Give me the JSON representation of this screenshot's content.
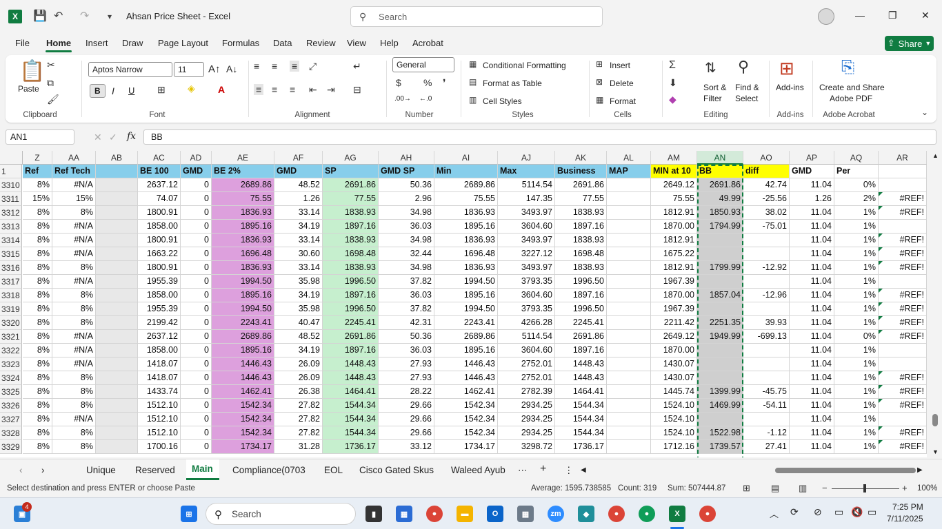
{
  "title": "Ahsan Price Sheet  -  Excel",
  "search_placeholder": "Search",
  "menu": [
    "File",
    "Home",
    "Insert",
    "Draw",
    "Page Layout",
    "Formulas",
    "Data",
    "Review",
    "View",
    "Help",
    "Acrobat"
  ],
  "share_label": "Share",
  "ribbon": {
    "clipboard": {
      "paste": "Paste",
      "label": "Clipboard"
    },
    "font": {
      "name": "Aptos Narrow",
      "size": "11",
      "label": "Font"
    },
    "alignment": {
      "label": "Alignment"
    },
    "number": {
      "format": "General",
      "label": "Number"
    },
    "styles": {
      "conditional": "Conditional Formatting",
      "format_table": "Format as Table",
      "cell_styles": "Cell Styles",
      "label": "Styles"
    },
    "cells": {
      "insert": "Insert",
      "delete": "Delete",
      "format": "Format",
      "label": "Cells"
    },
    "editing": {
      "sort": "Sort &",
      "filter": "Filter",
      "find": "Find &",
      "select": "Select",
      "label": "Editing"
    },
    "addins": {
      "addins": "Add-ins",
      "label": "Add-ins"
    },
    "acrobat": {
      "create1": "Create and Share",
      "create2": "Adobe PDF",
      "label": "Adobe Acrobat"
    }
  },
  "namebox": "AN1",
  "formula": "BB",
  "columns": [
    "Z",
    "AA",
    "AB",
    "AC",
    "AD",
    "AE",
    "AF",
    "AG",
    "AH",
    "AI",
    "AJ",
    "AK",
    "AL",
    "AM",
    "AN",
    "AO",
    "AP",
    "AQ",
    "AR"
  ],
  "header_row": {
    "num": "1",
    "cells": [
      "Ref",
      "Ref Tech",
      "",
      "BE 100",
      "GMD",
      "BE 2%",
      "GMD",
      "SP",
      "GMD SP",
      "Min",
      "Max",
      "Business",
      "MAP",
      "MIN at 10",
      "BB",
      "diff",
      "GMD",
      "Per",
      ""
    ]
  },
  "rows": [
    {
      "num": "3310",
      "cells": [
        "8%",
        "#N/A",
        "",
        "2637.12",
        "0",
        "2689.86",
        "48.52",
        "2691.86",
        "50.36",
        "2689.86",
        "5114.54",
        "2691.86",
        "",
        "2649.12",
        "2691.86",
        "42.74",
        "11.04",
        "0%",
        ""
      ]
    },
    {
      "num": "3311",
      "cells": [
        "15%",
        "15%",
        "",
        "74.07",
        "0",
        "75.55",
        "1.26",
        "77.55",
        "2.96",
        "75.55",
        "147.35",
        "77.55",
        "",
        "75.55",
        "49.99",
        "-25.56",
        "1.26",
        "2%",
        "#REF!"
      ]
    },
    {
      "num": "3312",
      "cells": [
        "8%",
        "8%",
        "",
        "1800.91",
        "0",
        "1836.93",
        "33.14",
        "1838.93",
        "34.98",
        "1836.93",
        "3493.97",
        "1838.93",
        "",
        "1812.91",
        "1850.93",
        "38.02",
        "11.04",
        "1%",
        "#REF!"
      ]
    },
    {
      "num": "3313",
      "cells": [
        "8%",
        "#N/A",
        "",
        "1858.00",
        "0",
        "1895.16",
        "34.19",
        "1897.16",
        "36.03",
        "1895.16",
        "3604.60",
        "1897.16",
        "",
        "1870.00",
        "1794.99",
        "-75.01",
        "11.04",
        "1%",
        ""
      ]
    },
    {
      "num": "3314",
      "cells": [
        "8%",
        "#N/A",
        "",
        "1800.91",
        "0",
        "1836.93",
        "33.14",
        "1838.93",
        "34.98",
        "1836.93",
        "3493.97",
        "1838.93",
        "",
        "1812.91",
        "",
        "",
        "11.04",
        "1%",
        "#REF!"
      ]
    },
    {
      "num": "3315",
      "cells": [
        "8%",
        "#N/A",
        "",
        "1663.22",
        "0",
        "1696.48",
        "30.60",
        "1698.48",
        "32.44",
        "1696.48",
        "3227.12",
        "1698.48",
        "",
        "1675.22",
        "",
        "",
        "11.04",
        "1%",
        "#REF!"
      ]
    },
    {
      "num": "3316",
      "cells": [
        "8%",
        "8%",
        "",
        "1800.91",
        "0",
        "1836.93",
        "33.14",
        "1838.93",
        "34.98",
        "1836.93",
        "3493.97",
        "1838.93",
        "",
        "1812.91",
        "1799.99",
        "-12.92",
        "11.04",
        "1%",
        "#REF!"
      ]
    },
    {
      "num": "3317",
      "cells": [
        "8%",
        "#N/A",
        "",
        "1955.39",
        "0",
        "1994.50",
        "35.98",
        "1996.50",
        "37.82",
        "1994.50",
        "3793.35",
        "1996.50",
        "",
        "1967.39",
        "",
        "",
        "11.04",
        "1%",
        ""
      ]
    },
    {
      "num": "3318",
      "cells": [
        "8%",
        "8%",
        "",
        "1858.00",
        "0",
        "1895.16",
        "34.19",
        "1897.16",
        "36.03",
        "1895.16",
        "3604.60",
        "1897.16",
        "",
        "1870.00",
        "1857.04",
        "-12.96",
        "11.04",
        "1%",
        "#REF!"
      ]
    },
    {
      "num": "3319",
      "cells": [
        "8%",
        "8%",
        "",
        "1955.39",
        "0",
        "1994.50",
        "35.98",
        "1996.50",
        "37.82",
        "1994.50",
        "3793.35",
        "1996.50",
        "",
        "1967.39",
        "",
        "",
        "11.04",
        "1%",
        "#REF!"
      ]
    },
    {
      "num": "3320",
      "cells": [
        "8%",
        "8%",
        "",
        "2199.42",
        "0",
        "2243.41",
        "40.47",
        "2245.41",
        "42.31",
        "2243.41",
        "4266.28",
        "2245.41",
        "",
        "2211.42",
        "2251.35",
        "39.93",
        "11.04",
        "1%",
        "#REF!"
      ]
    },
    {
      "num": "3321",
      "cells": [
        "8%",
        "#N/A",
        "",
        "2637.12",
        "0",
        "2689.86",
        "48.52",
        "2691.86",
        "50.36",
        "2689.86",
        "5114.54",
        "2691.86",
        "",
        "2649.12",
        "1949.99",
        "-699.13",
        "11.04",
        "0%",
        "#REF!"
      ]
    },
    {
      "num": "3322",
      "cells": [
        "8%",
        "#N/A",
        "",
        "1858.00",
        "0",
        "1895.16",
        "34.19",
        "1897.16",
        "36.03",
        "1895.16",
        "3604.60",
        "1897.16",
        "",
        "1870.00",
        "",
        "",
        "11.04",
        "1%",
        ""
      ]
    },
    {
      "num": "3323",
      "cells": [
        "8%",
        "#N/A",
        "",
        "1418.07",
        "0",
        "1446.43",
        "26.09",
        "1448.43",
        "27.93",
        "1446.43",
        "2752.01",
        "1448.43",
        "",
        "1430.07",
        "",
        "",
        "11.04",
        "1%",
        ""
      ]
    },
    {
      "num": "3324",
      "cells": [
        "8%",
        "8%",
        "",
        "1418.07",
        "0",
        "1446.43",
        "26.09",
        "1448.43",
        "27.93",
        "1446.43",
        "2752.01",
        "1448.43",
        "",
        "1430.07",
        "",
        "",
        "11.04",
        "1%",
        "#REF!"
      ]
    },
    {
      "num": "3325",
      "cells": [
        "8%",
        "8%",
        "",
        "1433.74",
        "0",
        "1462.41",
        "26.38",
        "1464.41",
        "28.22",
        "1462.41",
        "2782.39",
        "1464.41",
        "",
        "1445.74",
        "1399.99",
        "-45.75",
        "11.04",
        "1%",
        "#REF!"
      ]
    },
    {
      "num": "3326",
      "cells": [
        "8%",
        "8%",
        "",
        "1512.10",
        "0",
        "1542.34",
        "27.82",
        "1544.34",
        "29.66",
        "1542.34",
        "2934.25",
        "1544.34",
        "",
        "1524.10",
        "1469.99",
        "-54.11",
        "11.04",
        "1%",
        "#REF!"
      ]
    },
    {
      "num": "3327",
      "cells": [
        "8%",
        "#N/A",
        "",
        "1512.10",
        "0",
        "1542.34",
        "27.82",
        "1544.34",
        "29.66",
        "1542.34",
        "2934.25",
        "1544.34",
        "",
        "1524.10",
        "",
        "",
        "11.04",
        "1%",
        ""
      ]
    },
    {
      "num": "3328",
      "cells": [
        "8%",
        "8%",
        "",
        "1512.10",
        "0",
        "1542.34",
        "27.82",
        "1544.34",
        "29.66",
        "1542.34",
        "2934.25",
        "1544.34",
        "",
        "1524.10",
        "1522.98",
        "-1.12",
        "11.04",
        "1%",
        "#REF!"
      ]
    },
    {
      "num": "3329",
      "cells": [
        "8%",
        "8%",
        "",
        "1700.16",
        "0",
        "1734.17",
        "31.28",
        "1736.17",
        "33.12",
        "1734.17",
        "3298.72",
        "1736.17",
        "",
        "1712.16",
        "1739.57",
        "27.41",
        "11.04",
        "1%",
        "#REF!"
      ]
    }
  ],
  "sheet_tabs": [
    "Unique",
    "Reserved",
    "Main",
    "Compliance(0703",
    "EOL",
    "Cisco Gated Skus",
    "Waleed Ayub"
  ],
  "status": {
    "message": "Select destination and press ENTER or choose Paste",
    "average": "Average: 1595.738585",
    "count": "Count: 319",
    "sum": "Sum: 507444.87",
    "zoom": "100%"
  },
  "taskbar": {
    "search": "Search",
    "time": "7:25 PM",
    "date": "7/11/2025",
    "badge": "4"
  },
  "colors": {
    "accent": "#107c41",
    "col_sp": "#c6efce",
    "col_be2": "#dda0dd",
    "header_blue": "#87ceeb",
    "yellow": "#ffff00"
  }
}
